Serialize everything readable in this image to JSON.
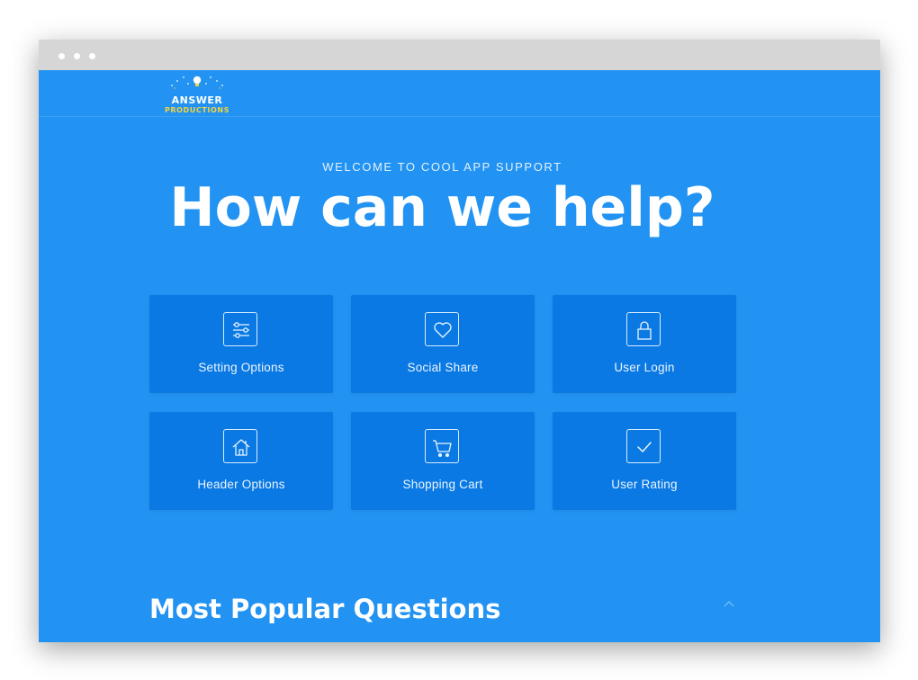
{
  "brand": {
    "line1": "ANSWER",
    "line2": "PRODUCTIONS",
    "accent_color": "#f5d23c",
    "icon": "lightbulb-icon"
  },
  "hero": {
    "eyebrow": "WELCOME TO COOL APP SUPPORT",
    "title": "How can we help?"
  },
  "categories": [
    {
      "label": "Setting Options",
      "icon": "sliders-icon"
    },
    {
      "label": "Social Share",
      "icon": "heart-icon"
    },
    {
      "label": "User Login",
      "icon": "lock-icon"
    },
    {
      "label": "Header Options",
      "icon": "home-icon"
    },
    {
      "label": "Shopping Cart",
      "icon": "cart-icon"
    },
    {
      "label": "User Rating",
      "icon": "checkmark-icon"
    }
  ],
  "popular": {
    "title": "Most Popular Questions"
  },
  "colors": {
    "page_bg": "#2293f2",
    "card_bg": "#0b79e3",
    "titlebar": "#d6d6d6"
  }
}
